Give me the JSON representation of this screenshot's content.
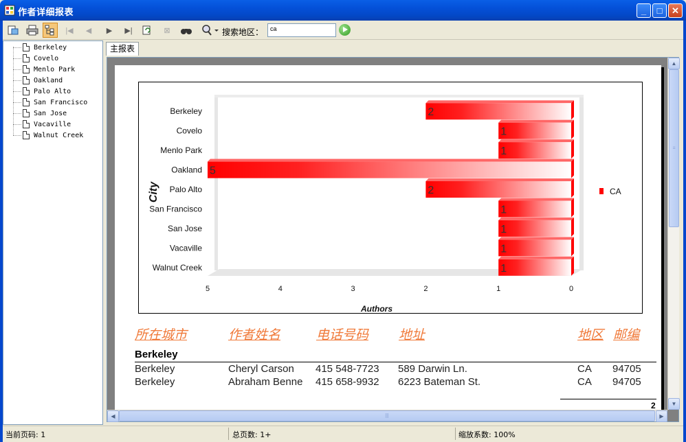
{
  "window": {
    "title": "作者详细报表"
  },
  "toolbar": {
    "search_label": "搜索地区：",
    "search_value": "ca",
    "buttons": [
      "export-icon",
      "print-icon",
      "tree-toggle-icon",
      "first-page-icon",
      "prev-page-icon",
      "next-page-icon",
      "last-page-icon",
      "refresh-icon",
      "stop-icon",
      "find-icon",
      "zoom-icon"
    ]
  },
  "tree": {
    "items": [
      "Berkeley",
      "Covelo",
      "Menlo Park",
      "Oakland",
      "Palo Alto",
      "San Francisco",
      "San Jose",
      "Vacaville",
      "Walnut Creek"
    ]
  },
  "tabs": [
    {
      "label": "主报表"
    }
  ],
  "chart_data": {
    "type": "bar",
    "orientation": "horizontal",
    "categories": [
      "Berkeley",
      "Covelo",
      "Menlo Park",
      "Oakland",
      "Palo Alto",
      "San Francisco",
      "San Jose",
      "Vacaville",
      "Walnut Creek"
    ],
    "series": [
      {
        "name": "CA",
        "values": [
          2,
          1,
          1,
          5,
          2,
          1,
          1,
          1,
          1
        ]
      }
    ],
    "xlabel": "Authors",
    "ylabel": "City",
    "xlim": [
      5,
      0
    ],
    "xticks": [
      5,
      4,
      3,
      2,
      1,
      0
    ],
    "legend_position": "right",
    "colors": {
      "bar": "#ff0000"
    }
  },
  "table": {
    "headers": {
      "city": "所在城市",
      "name": "作者姓名",
      "phone": "电话号码",
      "address": "地址",
      "state": "地区",
      "zip": "邮编"
    },
    "group": "Berkeley",
    "rows": [
      {
        "city": "Berkeley",
        "name": "Cheryl Carson",
        "phone": "415 548-7723",
        "address": "589 Darwin Ln.",
        "state": "CA",
        "zip": "94705"
      },
      {
        "city": "Berkeley",
        "name": "Abraham Benne",
        "phone": "415 658-9932",
        "address": "6223 Bateman St.",
        "state": "CA",
        "zip": "94705"
      }
    ],
    "page_number": "2"
  },
  "status": {
    "current_page": "当前页码: 1",
    "total_pages": "总页数: 1+",
    "zoom": "缩放系数: 100%"
  },
  "colors": {
    "title_accent": "#f07a3a",
    "titlebar": "#0450d8"
  }
}
